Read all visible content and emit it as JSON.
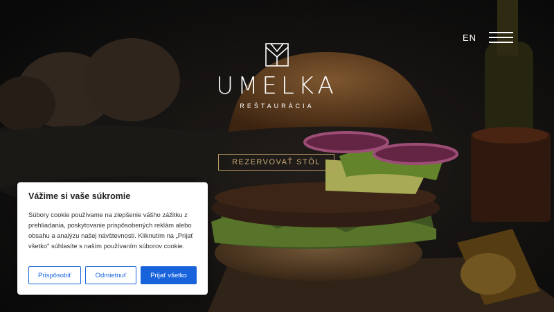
{
  "header": {
    "language": "EN",
    "menu_icon": "hamburger-menu-icon"
  },
  "brand": {
    "logo_icon": "umelka-logo-icon",
    "name": "UMELKA",
    "subtitle": "REŠTAURÁCIA"
  },
  "hero": {
    "reserve_label": "REZERVOVAŤ STÔL",
    "accent_color": "#b89a63"
  },
  "cookie_banner": {
    "title": "Vážime si vaše súkromie",
    "body": "Súbory cookie používame na zlepšenie vášho zážitku z prehliadania, poskytovanie prispôsobených reklám alebo obsahu a analýzu našej návštevnosti. Kliknutím na „Prijať všetko\" súhlasíte s naším používaním súborov cookie.",
    "customize_label": "Prispôsobiť",
    "reject_label": "Odmietnuť",
    "accept_label": "Prijať všetko",
    "button_color": "#1863dc"
  }
}
